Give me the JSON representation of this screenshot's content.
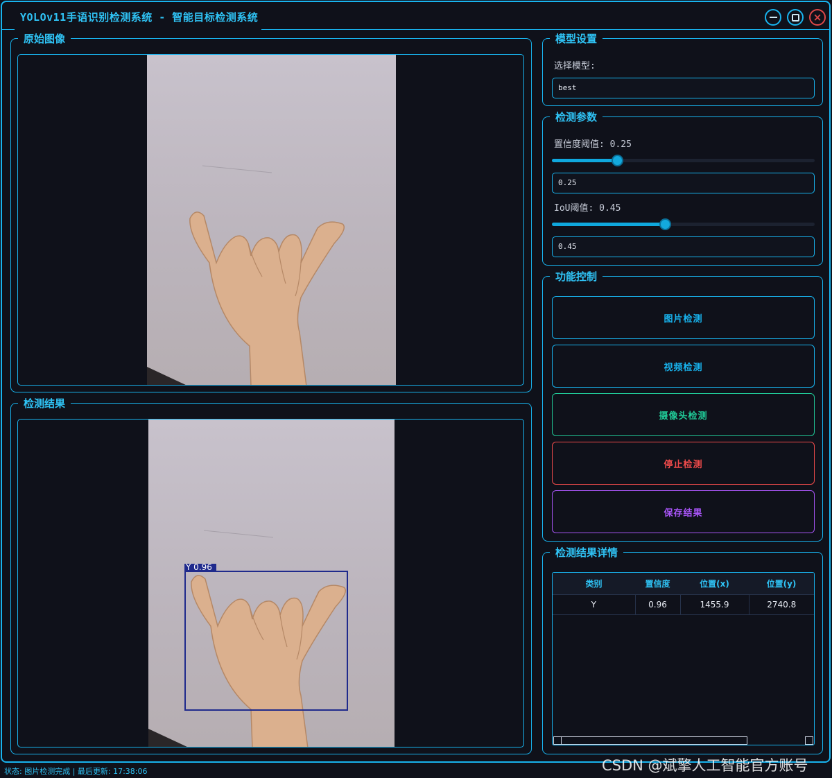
{
  "window": {
    "title": "YOLOv11手语识别检测系统 - 智能目标检测系统",
    "controls": [
      "minimize",
      "maximize",
      "close"
    ]
  },
  "panels": {
    "original_title": "原始图像",
    "result_title": "检测结果"
  },
  "detection_overlay": {
    "label": "Y 0.96",
    "box_color": "#1f2a8c"
  },
  "model_settings": {
    "title": "模型设置",
    "select_label": "选择模型:",
    "selected_model": "best"
  },
  "detection_params": {
    "title": "检测参数",
    "confidence_label": "置信度阈值: 0.25",
    "confidence_value": "0.25",
    "confidence_level": 0.25,
    "iou_label": "IoU阈值: 0.45",
    "iou_value": "0.45",
    "iou_level": 0.45
  },
  "function_control": {
    "title": "功能控制",
    "buttons": [
      {
        "label": "图片检测",
        "color": "#18b4ef"
      },
      {
        "label": "视频检测",
        "color": "#18b4ef"
      },
      {
        "label": "摄像头检测",
        "color": "#20c997"
      },
      {
        "label": "停止检测",
        "color": "#f04b4b"
      },
      {
        "label": "保存结果",
        "color": "#a855f7"
      }
    ]
  },
  "results_detail": {
    "title": "检测结果详情",
    "columns": [
      "类别",
      "置信度",
      "位置(x)",
      "位置(y)"
    ],
    "rows": [
      [
        "Y",
        "0.96",
        "1455.9",
        "2740.8"
      ]
    ]
  },
  "status_bar": {
    "text": "状态: 图片检测完成 | 最后更新: 17:38:06"
  },
  "watermark": "CSDN @斌擎人工智能官方账号"
}
